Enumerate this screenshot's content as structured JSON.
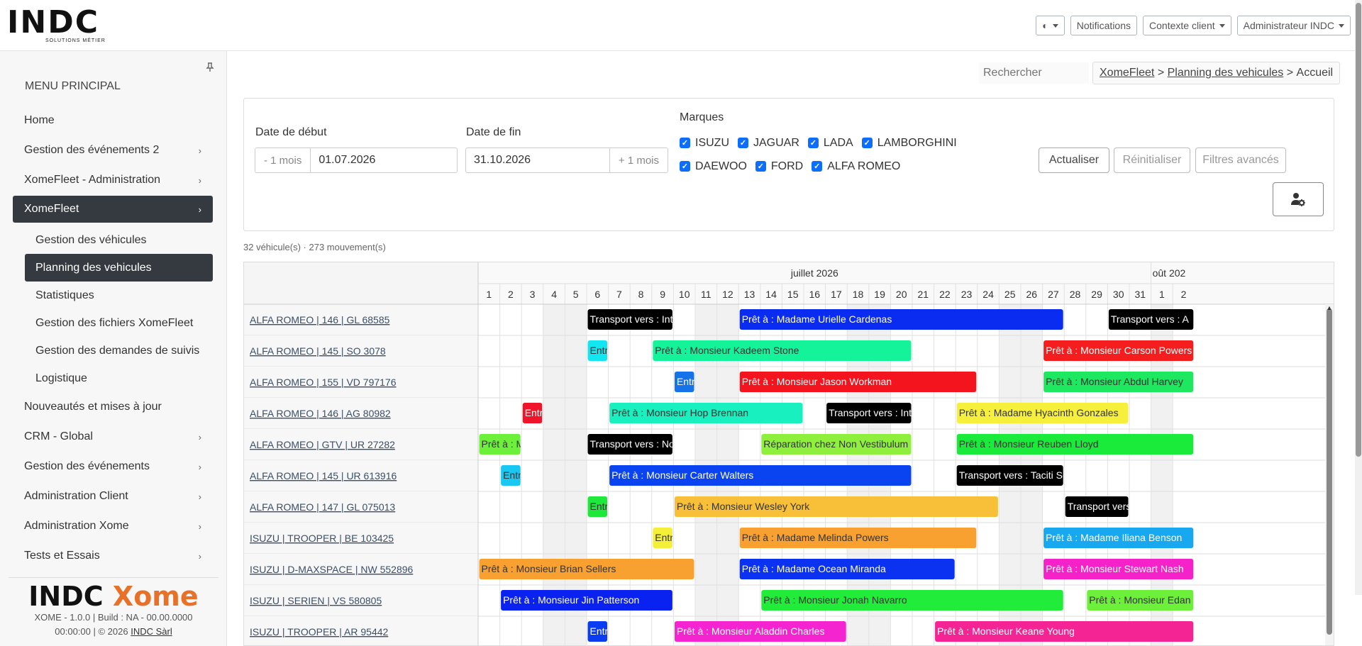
{
  "header": {
    "logo_text": "INDC",
    "logo_sub": "SOLUTIONS MÉTIER",
    "theme_label": "◐",
    "notifications": "Notifications",
    "context": "Contexte client",
    "admin": "Administrateur INDC"
  },
  "sidebar": {
    "title": "MENU PRINCIPAL",
    "items": [
      {
        "label": "Home",
        "chev": ""
      },
      {
        "label": "Gestion des événements 2",
        "chev": "›"
      },
      {
        "label": "XomeFleet - Administration",
        "chev": "›"
      }
    ],
    "active_item": {
      "label": "XomeFleet",
      "chev": "›"
    },
    "subitems": [
      {
        "label": "Gestion des véhicules"
      },
      {
        "label": "Planning des vehicules"
      },
      {
        "label": "Statistiques"
      },
      {
        "label": "Gestion des fichiers XomeFleet"
      },
      {
        "label": "Gestion des demandes de suivis"
      },
      {
        "label": "Logistique"
      }
    ],
    "items2": [
      {
        "label": "Nouveautés et mises à jour",
        "chev": ""
      },
      {
        "label": "CRM - Global",
        "chev": "›"
      },
      {
        "label": "Gestion des événements",
        "chev": "›"
      },
      {
        "label": "Administration Client",
        "chev": "›"
      },
      {
        "label": "Administration Xome",
        "chev": "›"
      },
      {
        "label": "Tests et Essais",
        "chev": "›"
      }
    ],
    "footer_logo_a": "INDC",
    "footer_logo_b": "Xome",
    "footer_line1": "XOME - 1.0.0 | Build : NA - 00.00.0000",
    "footer_line2": "00:00:00 | © 2026 ",
    "footer_link": "INDC Sàrl"
  },
  "search": {
    "placeholder": "Rechercher"
  },
  "breadcrumb": {
    "a": "XomeFleet",
    "sep1": " > ",
    "b": "Planning des vehicules",
    "sep2": " > ",
    "c": "Accueil"
  },
  "filters": {
    "start_label": "Date de début",
    "minus": "- 1 mois",
    "start": "01.07.2026",
    "end_label": "Date de fin",
    "end": "31.10.2026",
    "plus": "+ 1 mois",
    "brands_label": "Marques",
    "brands": [
      "ISUZU",
      "JAGUAR",
      "LADA",
      "LAMBORGHINI",
      "DAEWOO",
      "FORD",
      "ALFA ROMEO"
    ],
    "refresh": "Actualiser",
    "reset": "Réinitialiser",
    "advanced": "Filtres avancés"
  },
  "summary": "32 véhicule(s) · 273 mouvement(s)",
  "gantt": {
    "month1": "juillet 2026",
    "month2": "oût 202",
    "days": [
      "1",
      "2",
      "3",
      "4",
      "5",
      "6",
      "7",
      "8",
      "9",
      "10",
      "11",
      "12",
      "13",
      "14",
      "15",
      "16",
      "17",
      "18",
      "19",
      "20",
      "21",
      "22",
      "23",
      "24",
      "25",
      "26",
      "27",
      "28",
      "29",
      "30",
      "31",
      "1",
      "2"
    ],
    "weekend_days": [
      4,
      5,
      11,
      12,
      18,
      19,
      25,
      26,
      32
    ],
    "rows": [
      {
        "vehicle": "ALFA ROMEO | 146 | GL 68585",
        "bars": [
          {
            "s": 6,
            "e": 9,
            "label": "Transport vers : Integer",
            "color": "#000000",
            "text": "#ffffff"
          },
          {
            "s": 13,
            "e": 27,
            "label": "Prêt à : Madame Urielle Cardenas",
            "color": "#0a2cf0",
            "text": "#ffffff"
          },
          {
            "s": 30,
            "e": 33,
            "label": "Transport vers : A",
            "color": "#000000",
            "text": "#ffffff"
          }
        ]
      },
      {
        "vehicle": "ALFA ROMEO | 145 | SO 3078",
        "bars": [
          {
            "s": 6,
            "e": 6,
            "label": "Entré",
            "color": "#12e6f0",
            "text": "#333333"
          },
          {
            "s": 9,
            "e": 20,
            "label": "Prêt à : Monsieur Kadeem Stone",
            "color": "#14f29a",
            "text": "#333333"
          },
          {
            "s": 27,
            "e": 33,
            "label": "Prêt à : Monsieur Carson Powers",
            "color": "#f41e1e",
            "text": "#ffffff"
          }
        ]
      },
      {
        "vehicle": "ALFA ROMEO | 155 | VD 797176",
        "bars": [
          {
            "s": 10,
            "e": 10,
            "label": "Entré",
            "color": "#1572e8",
            "text": "#ffffff"
          },
          {
            "s": 13,
            "e": 23,
            "label": "Prêt à : Monsieur Jason Workman",
            "color": "#f4141e",
            "text": "#ffffff"
          },
          {
            "s": 27,
            "e": 33,
            "label": "Prêt à : Monsieur Abdul Harvey",
            "color": "#1ee860",
            "text": "#333333"
          }
        ]
      },
      {
        "vehicle": "ALFA ROMEO | 146 | AG 80982",
        "bars": [
          {
            "s": 3,
            "e": 3,
            "label": "Entré",
            "color": "#f0142a",
            "text": "#ffffff"
          },
          {
            "s": 7,
            "e": 15,
            "label": "Prêt à : Monsieur Hop Brennan",
            "color": "#18f0c0",
            "text": "#333333"
          },
          {
            "s": 17,
            "e": 20,
            "label": "Transport vers : Integer",
            "color": "#000000",
            "text": "#ffffff"
          },
          {
            "s": 23,
            "e": 30,
            "label": "Prêt à : Madame Hyacinth Gonzales",
            "color": "#f6f03c",
            "text": "#333333"
          }
        ]
      },
      {
        "vehicle": "ALFA ROMEO | GTV | UR 27282",
        "bars": [
          {
            "s": 1,
            "e": 2,
            "label": "Prêt à : Mo",
            "color": "#6cf03a",
            "text": "#333333"
          },
          {
            "s": 6,
            "e": 9,
            "label": "Transport vers : Non Ve",
            "color": "#000000",
            "text": "#ffffff"
          },
          {
            "s": 14,
            "e": 20,
            "label": "Réparation chez Non Vestibulum Nec Ass",
            "color": "#8ef03c",
            "text": "#333333"
          },
          {
            "s": 23,
            "e": 33,
            "label": "Prêt à : Monsieur Reuben Lloyd",
            "color": "#1aea3a",
            "text": "#333333"
          }
        ]
      },
      {
        "vehicle": "ALFA ROMEO | 145 | UR 613916",
        "bars": [
          {
            "s": 2,
            "e": 2,
            "label": "Entré",
            "color": "#18c8f0",
            "text": "#333333"
          },
          {
            "s": 7,
            "e": 20,
            "label": "Prêt à : Monsieur Carter Walters",
            "color": "#0a44f0",
            "text": "#ffffff"
          },
          {
            "s": 23,
            "e": 27,
            "label": "Transport vers : Taciti Sociosq",
            "color": "#000000",
            "text": "#ffffff"
          }
        ]
      },
      {
        "vehicle": "ALFA ROMEO | 147 | GL 075013",
        "bars": [
          {
            "s": 6,
            "e": 6,
            "label": "Entré",
            "color": "#1ee83a",
            "text": "#333333"
          },
          {
            "s": 10,
            "e": 24,
            "label": "Prêt à : Monsieur Wesley York",
            "color": "#f8c038",
            "text": "#333333"
          },
          {
            "s": 28,
            "e": 30,
            "label": "Transport vers : Ta",
            "color": "#000000",
            "text": "#ffffff"
          }
        ]
      },
      {
        "vehicle": "ISUZU | TROOPER | BE 103425",
        "bars": [
          {
            "s": 9,
            "e": 9,
            "label": "Entré",
            "color": "#f4f03a",
            "text": "#333333"
          },
          {
            "s": 13,
            "e": 23,
            "label": "Prêt à : Madame Melinda Powers",
            "color": "#f8a030",
            "text": "#333333"
          },
          {
            "s": 27,
            "e": 33,
            "label": "Prêt à : Madame Iliana Benson",
            "color": "#18a8f0",
            "text": "#ffffff"
          }
        ]
      },
      {
        "vehicle": "ISUZU | D-MAXSPACE | NW 552896",
        "bars": [
          {
            "s": 1,
            "e": 10,
            "label": "Prêt à : Monsieur Brian Sellers",
            "color": "#f8a030",
            "text": "#333333"
          },
          {
            "s": 13,
            "e": 22,
            "label": "Prêt à : Madame Ocean Miranda",
            "color": "#0a32f0",
            "text": "#ffffff"
          },
          {
            "s": 27,
            "e": 33,
            "label": "Prêt à : Monsieur Stewart Nash",
            "color": "#f422c8",
            "text": "#ffffff"
          }
        ]
      },
      {
        "vehicle": "ISUZU | SERIEN | VS 580805",
        "bars": [
          {
            "s": 2,
            "e": 9,
            "label": "Prêt à : Monsieur Jin Patterson",
            "color": "#0a22f0",
            "text": "#ffffff"
          },
          {
            "s": 14,
            "e": 27,
            "label": "Prêt à : Monsieur Jonah Navarro",
            "color": "#22ec3a",
            "text": "#333333"
          },
          {
            "s": 29,
            "e": 33,
            "label": "Prêt à : Monsieur Edan",
            "color": "#6cf03a",
            "text": "#333333"
          }
        ]
      },
      {
        "vehicle": "ISUZU | TROOPER | AR 95442",
        "bars": [
          {
            "s": 6,
            "e": 6,
            "label": "Entré",
            "color": "#0a3cf0",
            "text": "#ffffff"
          },
          {
            "s": 10,
            "e": 17,
            "label": "Prêt à : Monsieur Aladdin Charles",
            "color": "#f424d0",
            "text": "#ffffff"
          },
          {
            "s": 22,
            "e": 33,
            "label": "Prêt à : Monsieur Keane Young",
            "color": "#f42494",
            "text": "#ffffff"
          }
        ]
      }
    ]
  }
}
